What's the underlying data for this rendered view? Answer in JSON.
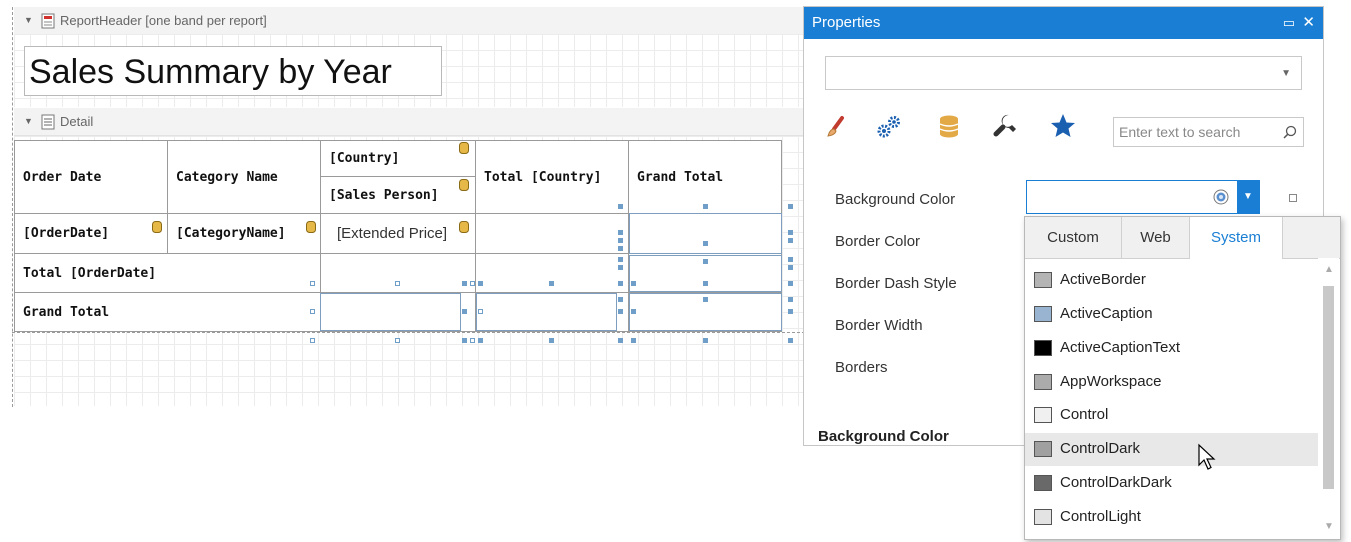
{
  "designer": {
    "report_header_band": "ReportHeader [one band per report]",
    "detail_band": "Detail",
    "report_title": "Sales Summary by Year",
    "crosstab": {
      "header_order_date": "Order Date",
      "header_category_name": "Category Name",
      "header_country": "[Country]",
      "header_sales_person": "[Sales Person]",
      "header_total_country": "Total [Country]",
      "header_grand_total": "Grand Total",
      "cell_order_date": "[OrderDate]",
      "cell_category_name": "[CategoryName]",
      "cell_extended_price": "[Extended Price]",
      "row_total_order_date": "Total [OrderDate]",
      "row_grand_total": "Grand Total"
    }
  },
  "properties": {
    "title": "Properties",
    "object_selector_value": "",
    "tabs": [
      "appearance-brush-icon",
      "behavior-gears-icon",
      "data-database-icon",
      "design-wrench-icon",
      "favorites-star-icon"
    ],
    "search_placeholder": "Enter text to search",
    "props": [
      {
        "label": "Background Color"
      },
      {
        "label": "Border Color"
      },
      {
        "label": "Border Dash Style"
      },
      {
        "label": "Border Width"
      },
      {
        "label": "Borders"
      }
    ],
    "section_title": "Background Color",
    "bg_editor_value": ""
  },
  "color_popup": {
    "tabs": [
      "Custom",
      "Web",
      "System"
    ],
    "active_tab": "System",
    "items": [
      {
        "name": "ActiveBorder",
        "color": "#b4b4b4"
      },
      {
        "name": "ActiveCaption",
        "color": "#99b4d1"
      },
      {
        "name": "ActiveCaptionText",
        "color": "#000000"
      },
      {
        "name": "AppWorkspace",
        "color": "#ababab"
      },
      {
        "name": "Control",
        "color": "#f0f0f0"
      },
      {
        "name": "ControlDark",
        "color": "#a0a0a0"
      },
      {
        "name": "ControlDarkDark",
        "color": "#696969"
      },
      {
        "name": "ControlLight",
        "color": "#e3e3e3"
      }
    ],
    "hovered_item": "ControlDark"
  },
  "colors": {
    "accent": "#1a7fd4",
    "grid_line": "#ececec",
    "selection": "#6f9ec8"
  }
}
